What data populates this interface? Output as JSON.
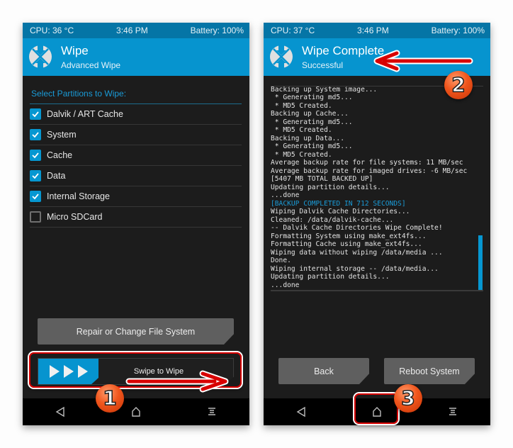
{
  "left_screen": {
    "status": {
      "cpu": "CPU: 36 °C",
      "time": "3:46 PM",
      "battery": "Battery: 100%"
    },
    "header": {
      "title": "Wipe",
      "subtitle": "Advanced Wipe",
      "logo_icon": "twrp-logo-icon"
    },
    "section_label": "Select Partitions to Wipe:",
    "partitions": [
      {
        "label": "Dalvik / ART Cache",
        "checked": true
      },
      {
        "label": "System",
        "checked": true
      },
      {
        "label": "Cache",
        "checked": true
      },
      {
        "label": "Data",
        "checked": true
      },
      {
        "label": "Internal Storage",
        "checked": true
      },
      {
        "label": "Micro SDCard",
        "checked": false
      }
    ],
    "repair_button": "Repair or Change File System",
    "swipe_label": "Swipe to Wipe",
    "nav": {
      "back_icon": "back-triangle-icon",
      "home_icon": "home-icon",
      "menu_icon": "menu-lines-icon"
    }
  },
  "right_screen": {
    "status": {
      "cpu": "CPU: 37 °C",
      "time": "3:46 PM",
      "battery": "Battery: 100%"
    },
    "header": {
      "title": "Wipe Complete",
      "subtitle": "Successful",
      "logo_icon": "twrp-logo-icon"
    },
    "console_lines": [
      {
        "text": "Backing up System image...",
        "highlight": false
      },
      {
        "text": " * Generating md5...",
        "highlight": false
      },
      {
        "text": " * MD5 Created.",
        "highlight": false
      },
      {
        "text": "Backing up Cache...",
        "highlight": false
      },
      {
        "text": " * Generating md5...",
        "highlight": false
      },
      {
        "text": " * MD5 Created.",
        "highlight": false
      },
      {
        "text": "Backing up Data...",
        "highlight": false
      },
      {
        "text": " * Generating md5...",
        "highlight": false
      },
      {
        "text": " * MD5 Created.",
        "highlight": false
      },
      {
        "text": "Average backup rate for file systems: 11 MB/sec",
        "highlight": false
      },
      {
        "text": "Average backup rate for imaged drives: -6 MB/sec",
        "highlight": false
      },
      {
        "text": "[5407 MB TOTAL BACKED UP]",
        "highlight": false
      },
      {
        "text": "Updating partition details...",
        "highlight": false
      },
      {
        "text": "...done",
        "highlight": false
      },
      {
        "text": "[BACKUP COMPLETED IN 712 SECONDS]",
        "highlight": true
      },
      {
        "text": "Wiping Dalvik Cache Directories...",
        "highlight": false
      },
      {
        "text": "Cleaned: /data/dalvik-cache...",
        "highlight": false
      },
      {
        "text": "-- Dalvik Cache Directories Wipe Complete!",
        "highlight": false
      },
      {
        "text": "Formatting System using make_ext4fs...",
        "highlight": false
      },
      {
        "text": "Formatting Cache using make_ext4fs...",
        "highlight": false
      },
      {
        "text": "Wiping data without wiping /data/media ...",
        "highlight": false
      },
      {
        "text": "Done.",
        "highlight": false
      },
      {
        "text": "Wiping internal storage -- /data/media...",
        "highlight": false
      },
      {
        "text": "Updating partition details...",
        "highlight": false
      },
      {
        "text": "...done",
        "highlight": false
      }
    ],
    "back_button": "Back",
    "reboot_button": "Reboot System",
    "nav": {
      "back_icon": "back-triangle-icon",
      "home_icon": "home-icon",
      "menu_icon": "menu-lines-icon"
    }
  },
  "annotations": {
    "step1": "1",
    "step2": "2",
    "step3": "3"
  },
  "colors": {
    "accent": "#0694cf",
    "status_bar": "#0575a6",
    "background": "#1c1c1c",
    "button": "#5f5f5f",
    "annotation_red": "#d80000",
    "badge_orange": "#f0561d"
  }
}
